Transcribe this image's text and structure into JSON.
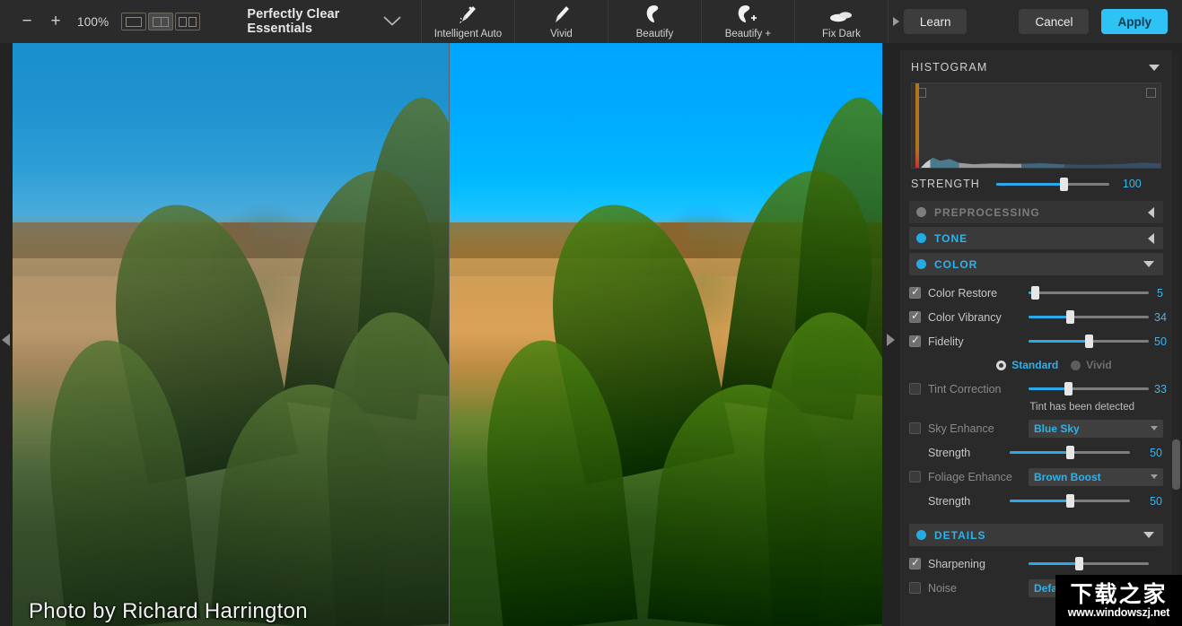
{
  "toolbar": {
    "zoom_out_label": "−",
    "zoom_in_label": "+",
    "zoom_level": "100%",
    "view_modes": [
      {
        "name": "single-view",
        "selected": false
      },
      {
        "name": "split-view",
        "selected": true
      },
      {
        "name": "side-by-side-view",
        "selected": false
      }
    ],
    "preset_name": "Perfectly Clear Essentials",
    "presets": [
      {
        "label": "Intelligent Auto",
        "icon": "magic-brush-icon"
      },
      {
        "label": "Vivid",
        "icon": "brush-icon"
      },
      {
        "label": "Beautify",
        "icon": "face-icon"
      },
      {
        "label": "Beautify +",
        "icon": "face-plus-icon"
      },
      {
        "label": "Fix Dark",
        "icon": "clouds-icon"
      }
    ],
    "learn_label": "Learn",
    "cancel_label": "Cancel",
    "apply_label": "Apply",
    "accent_color": "#2ec2f5"
  },
  "viewport": {
    "caption": "Photo by Richard Harrington",
    "left_arrow": "collapse-left-arrow",
    "right_arrow": "expand-right-arrow"
  },
  "panel": {
    "histogram": {
      "title": "HISTOGRAM",
      "collapse_state": "expanded"
    },
    "strength": {
      "label": "STRENGTH",
      "value": "100",
      "percent": 60
    },
    "sections": [
      {
        "label": "PREPROCESSING",
        "enabled": false,
        "expanded": false
      },
      {
        "label": "TONE",
        "enabled": true,
        "expanded": false
      },
      {
        "label": "COLOR",
        "enabled": true,
        "expanded": true
      },
      {
        "label": "DETAILS",
        "enabled": true,
        "expanded": true
      }
    ],
    "color": {
      "color_restore": {
        "label": "Color Restore",
        "checked": true,
        "value": "5",
        "percent": 5
      },
      "color_vibrancy": {
        "label": "Color Vibrancy",
        "checked": true,
        "value": "34",
        "percent": 34
      },
      "fidelity": {
        "label": "Fidelity",
        "checked": true,
        "value": "50",
        "percent": 50
      },
      "fidelity_modes": [
        {
          "label": "Standard",
          "selected": true
        },
        {
          "label": "Vivid",
          "selected": false
        }
      ],
      "tint_correction": {
        "label": "Tint Correction",
        "checked": false,
        "value": "33",
        "percent": 33
      },
      "tint_note": "Tint has been detected",
      "sky_enhance": {
        "label": "Sky Enhance",
        "checked": false,
        "option": "Blue Sky"
      },
      "sky_strength": {
        "label": "Strength",
        "value": "50",
        "percent": 50
      },
      "foliage_enhance": {
        "label": "Foliage Enhance",
        "checked": false,
        "option": "Brown Boost"
      },
      "foliage_strength": {
        "label": "Strength",
        "value": "50",
        "percent": 50
      }
    },
    "details": {
      "sharpening": {
        "label": "Sharpening",
        "checked": true,
        "percent": 42
      },
      "noise": {
        "label": "Noise",
        "checked": false,
        "option": "Default"
      }
    }
  },
  "watermark": {
    "chinese": "下载之家",
    "url": "www.windowszj.net"
  }
}
